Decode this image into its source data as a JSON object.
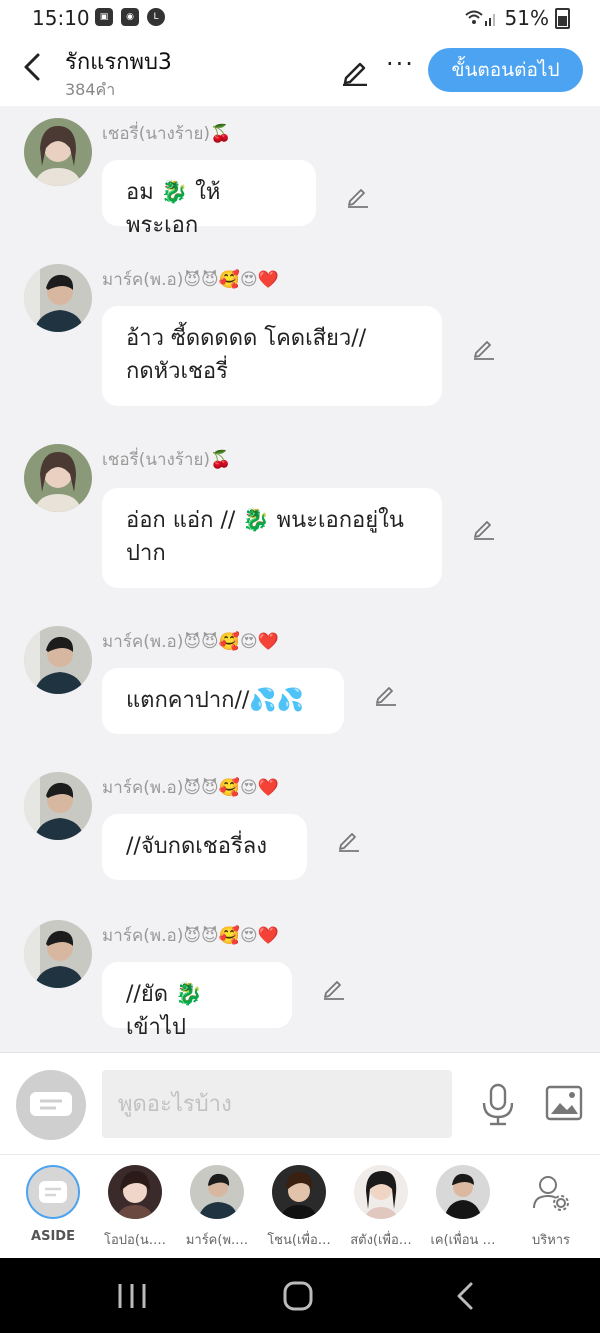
{
  "status_bar": {
    "time": "15:10",
    "battery": "51%",
    "notification_icons": [
      "gallery-icon",
      "camera-icon",
      "line-icon"
    ]
  },
  "header": {
    "title": "รักแรกพบ3",
    "word_count": "384คำ",
    "next_button": "ขั้นตอนต่อไป"
  },
  "messages": [
    {
      "sender": "เชอรี่(นางร้าย)🍒",
      "text": "อม 🐉 ให้พระเอก",
      "avatar": "female"
    },
    {
      "sender": "มาร์ค(พ.อ)😈😈🥰😍❤️",
      "text": "อ้าว ซี้ดดดดด โคดเสียว// กดหัวเชอรี่",
      "avatar": "male"
    },
    {
      "sender": "เชอรี่(นางร้าย)🍒",
      "text": "อ่อก แอ่ก // 🐉 พนะเอกอยู่ใน ปาก",
      "avatar": "female"
    },
    {
      "sender": "มาร์ค(พ.อ)😈😈🥰😍❤️",
      "text": "แตกคาปาก//💦💦",
      "avatar": "male"
    },
    {
      "sender": "มาร์ค(พ.อ)😈😈🥰😍❤️",
      "text": "//จับกดเชอรี่ลง",
      "avatar": "male"
    },
    {
      "sender": "มาร์ค(พ.อ)😈😈🥰😍❤️",
      "text": "//ยัด 🐉 เข้าไป",
      "avatar": "male"
    }
  ],
  "input": {
    "placeholder": "พูดอะไรบ้าง"
  },
  "characters": [
    {
      "label": "ASIDE"
    },
    {
      "label": "โอปอ(น.…"
    },
    {
      "label": "มาร์ค(พ.…"
    },
    {
      "label": "โชน(เพื่อ…"
    },
    {
      "label": "สตัง(เพื่อ…"
    },
    {
      "label": "เค(เพื่อน …"
    },
    {
      "label": "บริหาร"
    }
  ],
  "colors": {
    "accent": "#4ba3f2",
    "background": "#f2f2f4"
  }
}
